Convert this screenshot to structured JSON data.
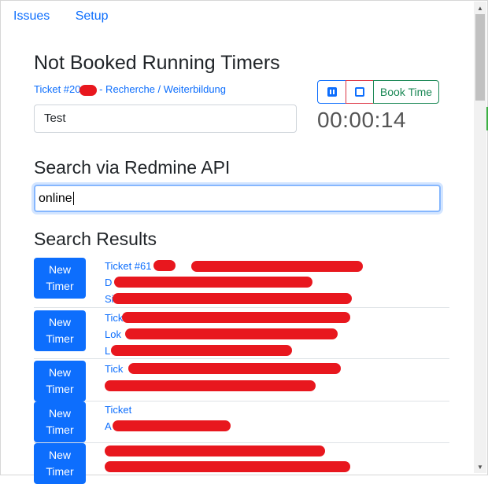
{
  "nav": {
    "issues": "Issues",
    "setup": "Setup"
  },
  "timers": {
    "title": "Not Booked Running Timers",
    "ticket_prefix": "Ticket #20",
    "ticket_suffix": " - Recherche / Weiterbildung",
    "note_value": "Test",
    "book_label": "Book Time",
    "elapsed": "00:00:14"
  },
  "search": {
    "title": "Search via Redmine API",
    "query": "online"
  },
  "results": {
    "title": "Search Results",
    "new_timer_label_1": "New",
    "new_timer_label_2": "Timer",
    "rows": [
      {
        "line1": "Ticket #61",
        "line2": "D",
        "line3": "Si"
      },
      {
        "line1": "Tick",
        "line2": "Lok",
        "line3": "L"
      },
      {
        "line1": "Tick",
        "line2": "",
        "line3": ""
      },
      {
        "line1": "Ticket",
        "line2": "A",
        "line3": ""
      },
      {
        "line1": "",
        "line2": "",
        "line3": ""
      }
    ]
  },
  "colors": {
    "primary": "#0d6efd",
    "danger": "#dc3545",
    "success": "#198754",
    "redaction": "#e8171e"
  }
}
